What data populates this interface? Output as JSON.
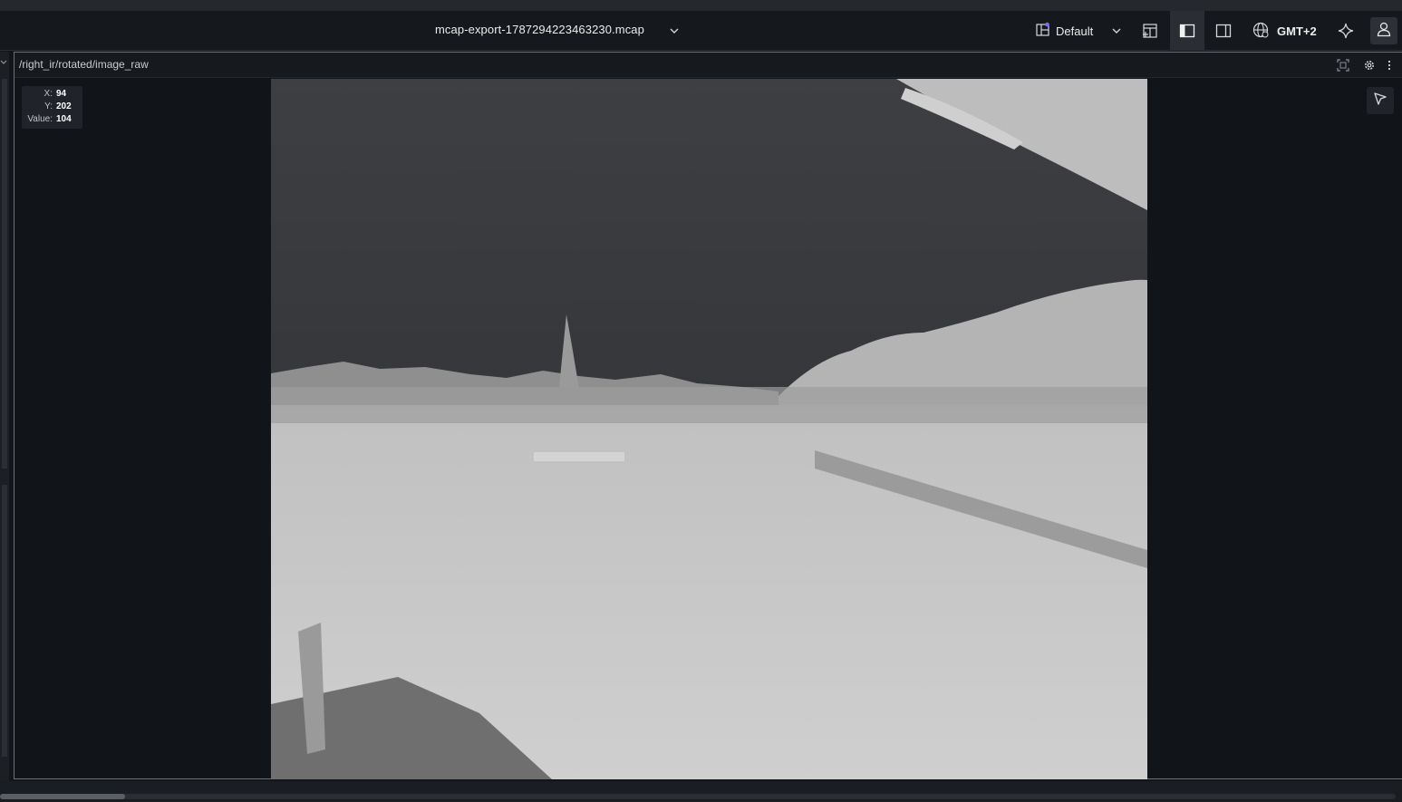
{
  "titlebar": {
    "file_name": "mcap-export-1787294223463230.mcap",
    "layout_label": "Default",
    "timezone_label": "GMT+2"
  },
  "panel": {
    "topic_title": "/right_ir/rotated/image_raw",
    "pixel_readout": {
      "x_label": "X:",
      "x_value": "94",
      "y_label": "Y:",
      "y_value": "202",
      "value_label": "Value:",
      "value_value": "104"
    }
  },
  "colors": {
    "accent_border": "#6b5fd6",
    "layout_dot": "#7b6cf0",
    "background": "#121519"
  },
  "icons": {
    "file_dropdown": "chevron-down-icon",
    "layout": "layout-icon",
    "add_panel": "add-panel-icon",
    "left_sidebar": "left-sidebar-icon",
    "right_sidebar": "right-sidebar-icon",
    "timezone": "globe-icon",
    "ai": "sparkle-icon",
    "user": "user-icon",
    "fullscreen": "fullscreen-icon",
    "settings": "gear-icon",
    "more": "more-vertical-icon",
    "select_tool": "cursor-arrow-icon"
  },
  "scrollbar": {
    "position_fraction": 0.0
  }
}
